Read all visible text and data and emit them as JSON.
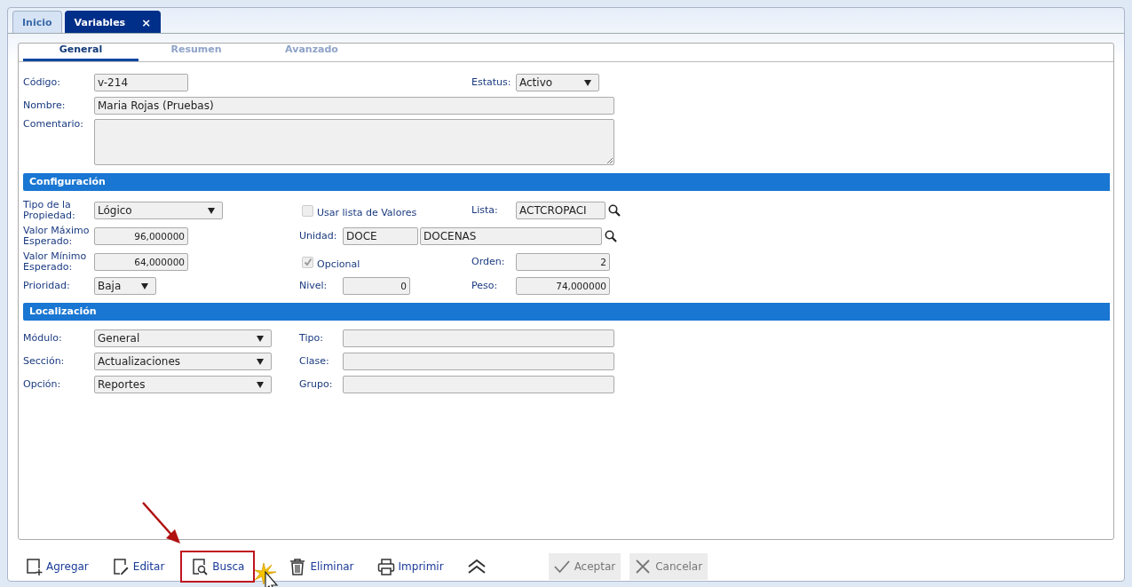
{
  "tabs": [
    {
      "label": "Inicio",
      "selected": false
    },
    {
      "label": "Variables",
      "selected": true,
      "close": "×"
    }
  ],
  "subtabs": [
    {
      "label": "General",
      "selected": true
    },
    {
      "label": "Resumen",
      "selected": false
    },
    {
      "label": "Avanzado",
      "selected": false
    }
  ],
  "general": {
    "codigo": {
      "label": "Código:",
      "value": "v-214"
    },
    "estatus": {
      "label": "Estatus:",
      "value": "Activo"
    },
    "nombre": {
      "label": "Nombre:",
      "value": "Maria Rojas (Pruebas)"
    },
    "comentario": {
      "label": "Comentario:"
    }
  },
  "configuracion": {
    "title": "Configuración",
    "tipo": {
      "label": "Tipo de la Propiedad:",
      "value": "Lógico"
    },
    "usar_lista": {
      "label": "Usar lista de Valores",
      "checked": false,
      "disabled": true
    },
    "lista": {
      "label": "Lista:",
      "value": "ACTCROPACI"
    },
    "valor_max": {
      "label": "Valor Máximo Esperado:",
      "value": "96,000000"
    },
    "unidad": {
      "label": "Unidad:",
      "code": "DOCE",
      "value": "DOCENAS"
    },
    "valor_min": {
      "label": "Valor Mínimo Esperado:",
      "value": "64,000000"
    },
    "opcional": {
      "label": "Opcional",
      "checked": true,
      "disabled": true
    },
    "orden": {
      "label": "Orden:",
      "value": "2"
    },
    "prioridad": {
      "label": "Prioridad:",
      "value": "Baja"
    },
    "nivel": {
      "label": "Nivel:",
      "value": "0"
    },
    "peso": {
      "label": "Peso:",
      "value": "74,000000"
    }
  },
  "localizacion": {
    "title": "Localización",
    "rows": [
      {
        "select_label": "Módulo:",
        "select_value": "General",
        "field_label": "Tipo:"
      },
      {
        "select_label": "Sección:",
        "select_value": "Actualizaciones",
        "field_label": "Clase:"
      },
      {
        "select_label": "Opción:",
        "select_value": "Reportes",
        "field_label": "Grupo:"
      }
    ]
  },
  "toolbar": [
    {
      "kind": "add",
      "label": "Agregar",
      "highlighted": false
    },
    {
      "kind": "edit",
      "label": "Editar",
      "highlighted": false
    },
    {
      "kind": "search",
      "label": "Busca",
      "highlighted": true
    },
    {
      "kind": "delete",
      "label": "Eliminar",
      "highlighted": false
    },
    {
      "kind": "print",
      "label": "Imprimir",
      "highlighted": false
    },
    {
      "kind": "collapse",
      "highlighted": false
    }
  ],
  "actions": [
    {
      "kind": "accept",
      "label": "Aceptar",
      "disabled": true
    },
    {
      "kind": "cancel",
      "label": "Cancelar",
      "disabled": true
    }
  ]
}
